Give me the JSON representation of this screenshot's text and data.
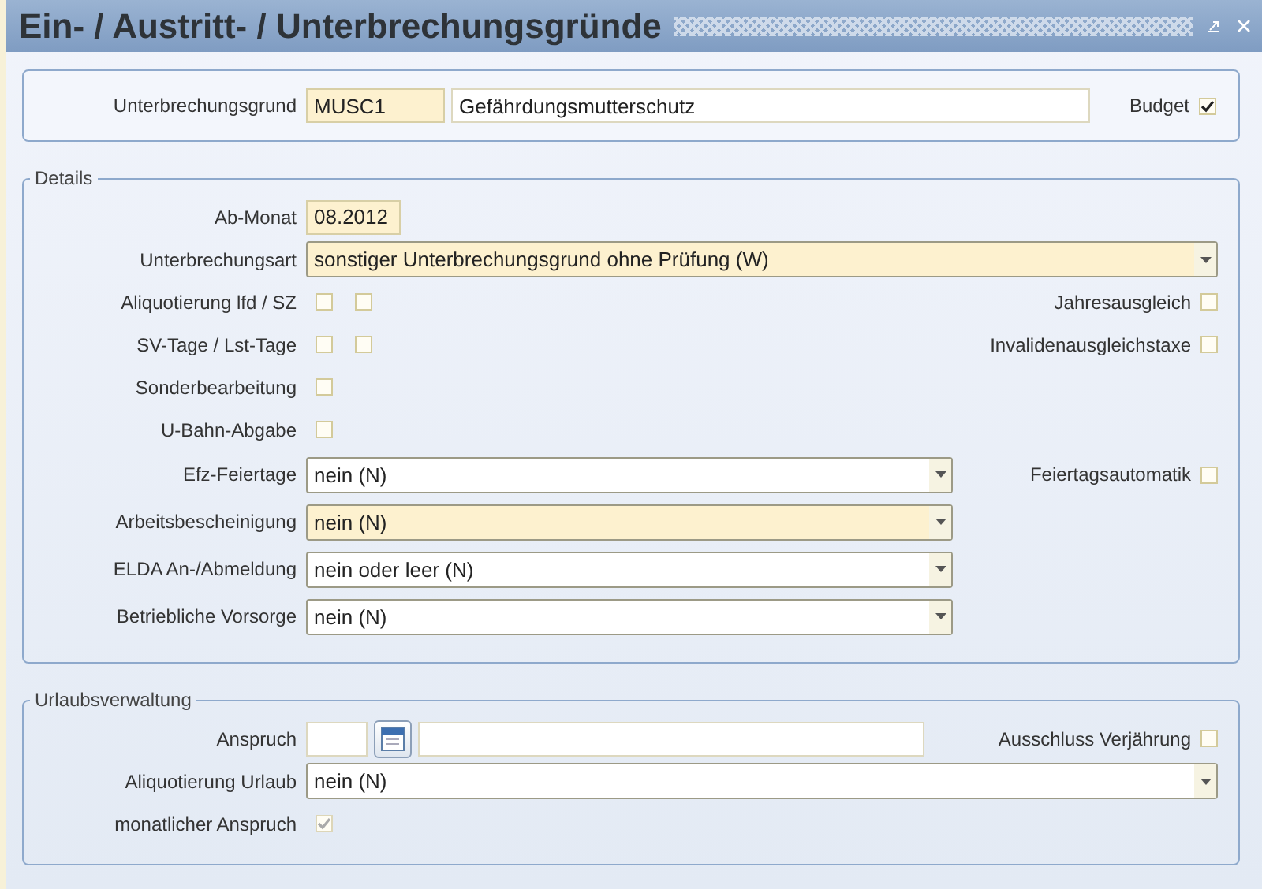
{
  "window": {
    "title": "Ein- / Austritt- / Unterbrechungsgründe"
  },
  "header": {
    "label": "Unterbrechungsgrund",
    "code": "MUSC1",
    "description": "Gefährdungsmutterschutz",
    "budget": {
      "label": "Budget",
      "checked": true
    }
  },
  "details": {
    "legend": "Details",
    "rows": [
      {
        "kind": "input",
        "label": "Ab-Monat",
        "value": "08.2012",
        "required": true
      },
      {
        "kind": "select",
        "label": "Unterbrechungsart",
        "value": "sonstiger Unterbrechungsgrund ohne Prüfung (W)",
        "required": true,
        "wide": true
      },
      {
        "kind": "checks",
        "label": "Aliquotierung lfd / SZ",
        "checks": [
          {
            "checked": false
          },
          {
            "checked": false
          }
        ],
        "aside": {
          "label": "Jahresausgleich",
          "checked": false
        }
      },
      {
        "kind": "checks",
        "label": "SV-Tage / Lst-Tage",
        "checks": [
          {
            "checked": false
          },
          {
            "checked": false
          }
        ],
        "aside": {
          "label": "Invalidenausgleichstaxe",
          "checked": false
        }
      },
      {
        "kind": "checks",
        "label": "Sonderbearbeitung",
        "checks": [
          {
            "checked": false
          }
        ]
      },
      {
        "kind": "checks",
        "label": "U-Bahn-Abgabe",
        "checks": [
          {
            "checked": false
          }
        ]
      },
      {
        "kind": "select",
        "label": "Efz-Feiertage",
        "value": "nein (N)",
        "required": false,
        "wide": false,
        "aside": {
          "label": "Feiertagsautomatik",
          "checked": false
        }
      },
      {
        "kind": "select",
        "label": "Arbeitsbescheinigung",
        "value": "nein (N)",
        "required": true,
        "wide": false
      },
      {
        "kind": "select",
        "label": "ELDA An-/Abmeldung",
        "value": "nein oder leer (N)",
        "required": false,
        "wide": false
      },
      {
        "kind": "select",
        "label": "Betriebliche Vorsorge",
        "value": "nein (N)",
        "required": false,
        "wide": false
      }
    ]
  },
  "vacation": {
    "legend": "Urlaubsverwaltung",
    "rows": [
      {
        "kind": "amount",
        "label": "Anspruch",
        "aside": {
          "label": "Ausschluss Verjährung",
          "checked": false
        }
      },
      {
        "kind": "select",
        "label": "Aliquotierung Urlaub",
        "value": "nein (N)",
        "required": false,
        "wide": true
      },
      {
        "kind": "checks",
        "label": "monatlicher Anspruch",
        "checks": [
          {
            "checked": true,
            "disabled": true
          }
        ]
      }
    ]
  }
}
